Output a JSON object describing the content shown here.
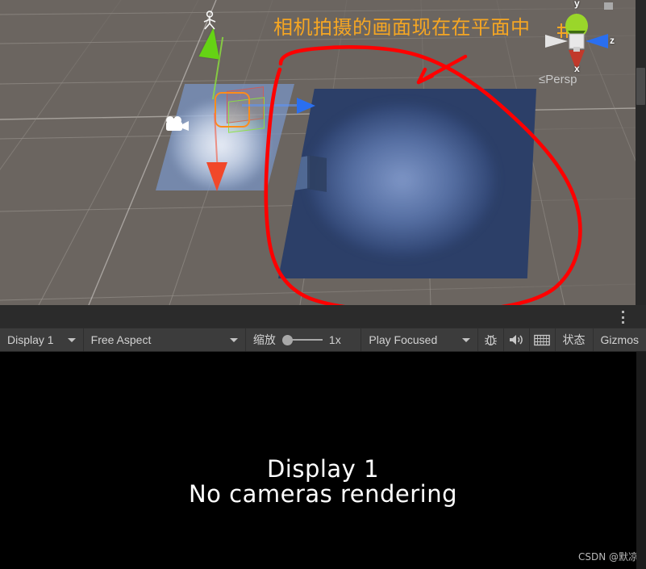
{
  "scene_view": {
    "name": "Scene View",
    "background_color": "#6b6560",
    "grid_color": "#8b8680",
    "objects": {
      "ground_plane": {
        "name": "Plane",
        "color": "#7896c8",
        "glow_color": "#f3f6fc"
      },
      "camera_feed_plane": {
        "name": "Camera Render Plane",
        "color": "#2c3f68",
        "glow_color": "#96afe1",
        "cube_shadow_color": "#2e3f60"
      },
      "selected_object": {
        "name": "Cube",
        "selection_outline_color": "#ff8c1a",
        "wire_green_color": "#8ce23c",
        "wire_red_color": "#d65850"
      },
      "camera_gizmo": {
        "icon": "movie-camera-icon",
        "color": "#ffffff"
      },
      "light_gizmo": {
        "icon": "light-icon",
        "color": "#ffffff"
      }
    },
    "move_gizmo": {
      "axis_y_color": "#65d314",
      "axis_x_color": "#f1482a",
      "axis_z_color": "#2a6ff0"
    },
    "scene_gizmo": {
      "axis_labels": {
        "y": "y",
        "z": "z",
        "x": "x"
      },
      "projection_label": "Persp",
      "projection_prefix": "≤",
      "cone_y_color": "#9ad62a",
      "cone_z_color": "#2a6ff0",
      "cone_x_color": "#c1392b",
      "cone_neutral_color": "#e4e4e4"
    },
    "snap_icon": "grid-snap-icon"
  },
  "annotation": {
    "text": "相机拍摄的画面现在在平面中",
    "text_color": "#f5a623",
    "stroke_color": "#ff0000",
    "shapes": [
      "circle-lasso",
      "arrow-pointer"
    ]
  },
  "tab_bar": {
    "kebab_menu_label": "more-options"
  },
  "game_toolbar": {
    "display_selector": {
      "label": "Display 1",
      "icon": "chevron-down-icon"
    },
    "aspect_selector": {
      "label": "Free Aspect",
      "icon": "chevron-down-icon"
    },
    "scale": {
      "label": "缩放",
      "value": "1x",
      "slider_position_percent": 0
    },
    "play_mode_selector": {
      "label": "Play Focused",
      "icon": "chevron-down-icon"
    },
    "buttons": [
      {
        "name": "stats-bug-button",
        "icon": "bug-icon",
        "label": ""
      },
      {
        "name": "mute-audio-button",
        "icon": "speaker-icon",
        "label": ""
      },
      {
        "name": "gizmo-grid-button",
        "icon": "grid-icon",
        "label": ""
      },
      {
        "name": "stats-button",
        "icon": "",
        "label": "状态"
      },
      {
        "name": "gizmos-button",
        "icon": "",
        "label": "Gizmos"
      }
    ]
  },
  "game_view": {
    "message_line1": "Display 1",
    "message_line2": "No cameras rendering",
    "background_color": "#000000",
    "text_color": "#ffffff"
  },
  "watermark": {
    "text": "CSDN @默凉"
  }
}
